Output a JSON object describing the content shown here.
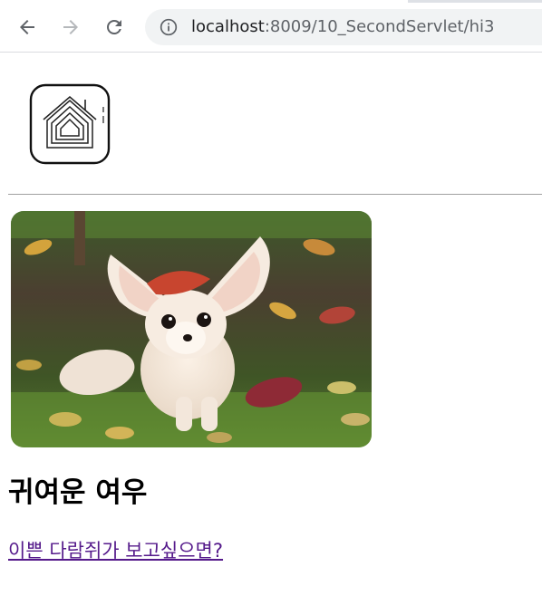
{
  "browser": {
    "url_host": "localhost",
    "url_rest": ":8009/10_SecondServlet/hi3"
  },
  "page": {
    "logo_alt": "home-app-logo",
    "heading": "귀여운 여우",
    "link_text": "이쁜 다람쥐가 보고싶으면?",
    "colors": {
      "link_visited": "#551a8b",
      "rule": "#a0a0a0",
      "omnibox_bg": "#f1f3f4"
    }
  }
}
